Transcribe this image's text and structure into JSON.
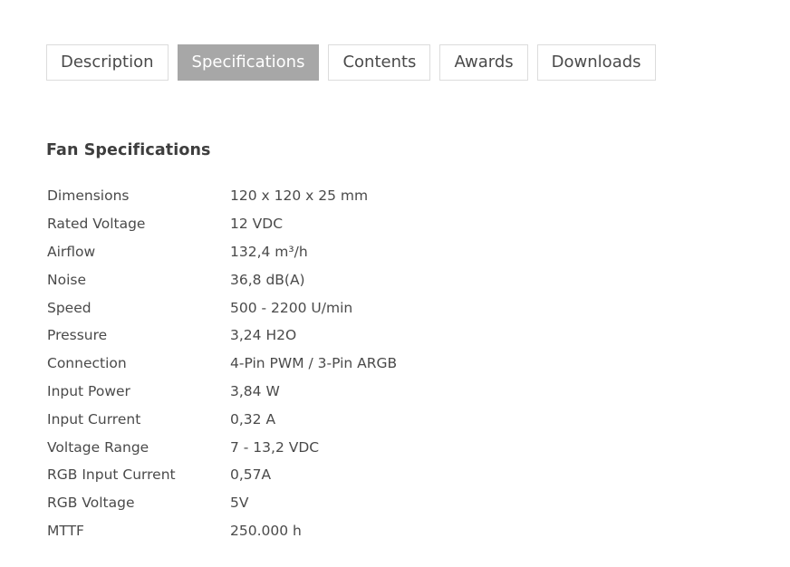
{
  "tabs": [
    {
      "label": "Description",
      "active": false
    },
    {
      "label": "Specifications",
      "active": true
    },
    {
      "label": "Contents",
      "active": false
    },
    {
      "label": "Awards",
      "active": false
    },
    {
      "label": "Downloads",
      "active": false
    }
  ],
  "section": {
    "title": "Fan Specifications"
  },
  "specs": [
    {
      "label": "Dimensions",
      "value": "120 x 120 x 25 mm"
    },
    {
      "label": "Rated Voltage",
      "value": "12 VDC"
    },
    {
      "label": "Airflow",
      "value": "132,4 m³/h"
    },
    {
      "label": "Noise",
      "value": "36,8 dB(A)"
    },
    {
      "label": "Speed",
      "value": "500 - 2200 U/min"
    },
    {
      "label": "Pressure",
      "value": "3,24 H2O"
    },
    {
      "label": "Connection",
      "value": "4-Pin PWM / 3-Pin ARGB"
    },
    {
      "label": "Input Power",
      "value": "3,84 W"
    },
    {
      "label": "Input Current",
      "value": "0,32 A"
    },
    {
      "label": "Voltage Range",
      "value": "7 - 13,2 VDC"
    },
    {
      "label": "RGB Input Current",
      "value": "0,57A"
    },
    {
      "label": "RGB Voltage",
      "value": "5V"
    },
    {
      "label": "MTTF",
      "value": "250.000 h"
    }
  ],
  "colors": {
    "active_tab_bg": "#a7a7a7",
    "tab_border": "#dcdcdc",
    "text": "#4a4a4a"
  }
}
